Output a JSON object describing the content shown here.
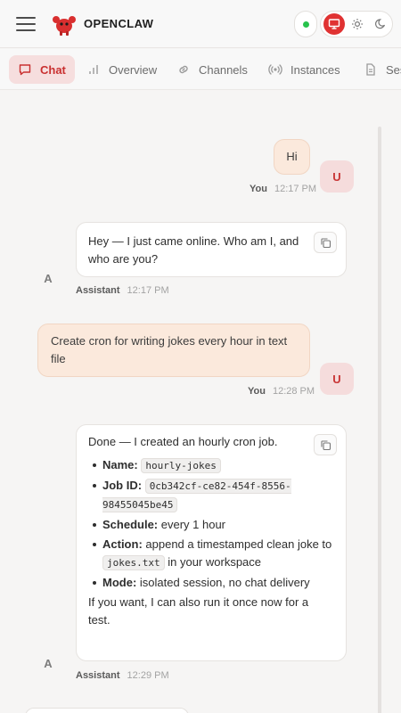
{
  "header": {
    "brand": "OPENCLAW",
    "menu_icon": "hamburger-icon",
    "logo_icon": "lobster-logo-icon",
    "status_color": "#27c24c",
    "theme_options": [
      "monitor-icon",
      "sun-icon",
      "moon-icon"
    ],
    "accent": "#e03232"
  },
  "tabs": [
    {
      "label": "Chat",
      "icon": "chat-icon",
      "active": true
    },
    {
      "label": "Overview",
      "icon": "bar-chart-icon"
    },
    {
      "label": "Channels",
      "icon": "link-icon"
    },
    {
      "label": "Instances",
      "icon": "radio-icon"
    },
    {
      "label": "Ses",
      "icon": "file-icon"
    }
  ],
  "messages": [
    {
      "role": "user",
      "avatar": "U",
      "text": "Hi",
      "who": "You",
      "time": "12:17 PM"
    },
    {
      "role": "assistant",
      "avatar": "A",
      "text": "Hey — I just came online. Who am I, and who are you?",
      "who": "Assistant",
      "time": "12:17 PM"
    },
    {
      "role": "user",
      "avatar": "U",
      "text": "Create cron for writing jokes every hour in text file",
      "who": "You",
      "time": "12:28 PM"
    },
    {
      "role": "assistant",
      "avatar": "A",
      "intro": "Done — I created an hourly cron job.",
      "items": [
        {
          "label": "Name:",
          "code": "hourly-jokes"
        },
        {
          "label": "Job ID:",
          "code": "0cb342cf-ce82-454f-8556-98455045be45"
        },
        {
          "label": "Schedule:",
          "text": "every 1 hour"
        },
        {
          "label": "Action:",
          "text_before": "append a timestamped clean joke to",
          "code": "jokes.txt",
          "text_after": "in your workspace"
        },
        {
          "label": "Mode:",
          "text": "isolated session, no chat delivery"
        }
      ],
      "outro": "If you want, I can also run it once now for a test.",
      "who": "Assistant",
      "time": "12:29 PM"
    }
  ]
}
